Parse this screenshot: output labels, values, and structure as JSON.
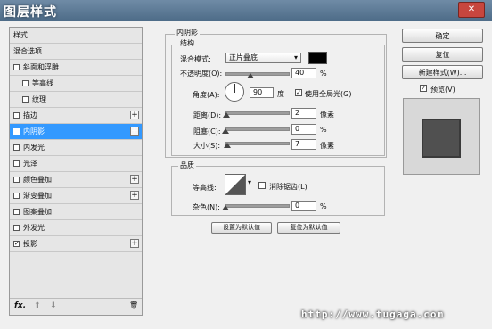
{
  "window": {
    "title": "图层样式",
    "close": "✕"
  },
  "sidebar": {
    "items": [
      {
        "label": "样式",
        "checkbox": false,
        "checked": false,
        "plus": false,
        "indent": false,
        "selected": false
      },
      {
        "label": "混合选项",
        "checkbox": false,
        "checked": false,
        "plus": false,
        "indent": false,
        "selected": false
      },
      {
        "label": "斜面和浮雕",
        "checkbox": true,
        "checked": false,
        "plus": false,
        "indent": false,
        "selected": false
      },
      {
        "label": "等高线",
        "checkbox": true,
        "checked": false,
        "plus": false,
        "indent": true,
        "selected": false
      },
      {
        "label": "纹理",
        "checkbox": true,
        "checked": false,
        "plus": false,
        "indent": true,
        "selected": false
      },
      {
        "label": "描边",
        "checkbox": true,
        "checked": false,
        "plus": true,
        "indent": false,
        "selected": false
      },
      {
        "label": "内阴影",
        "checkbox": true,
        "checked": true,
        "plus": true,
        "indent": false,
        "selected": true
      },
      {
        "label": "内发光",
        "checkbox": true,
        "checked": false,
        "plus": false,
        "indent": false,
        "selected": false
      },
      {
        "label": "光泽",
        "checkbox": true,
        "checked": false,
        "plus": false,
        "indent": false,
        "selected": false
      },
      {
        "label": "颜色叠加",
        "checkbox": true,
        "checked": false,
        "plus": true,
        "indent": false,
        "selected": false
      },
      {
        "label": "渐变叠加",
        "checkbox": true,
        "checked": false,
        "plus": true,
        "indent": false,
        "selected": false
      },
      {
        "label": "图案叠加",
        "checkbox": true,
        "checked": false,
        "plus": false,
        "indent": false,
        "selected": false
      },
      {
        "label": "外发光",
        "checkbox": true,
        "checked": false,
        "plus": false,
        "indent": false,
        "selected": false
      },
      {
        "label": "投影",
        "checkbox": true,
        "checked": true,
        "plus": true,
        "indent": false,
        "selected": false
      }
    ],
    "footer": {
      "fx": "fx.",
      "up": "⬆",
      "down": "⬇",
      "trash": "🗑"
    }
  },
  "inner_shadow": {
    "section_title": "内阴影",
    "structure_title": "结构",
    "blend_mode_label": "混合模式:",
    "blend_mode_value": "正片叠底",
    "shadow_color": "#000000",
    "opacity_label": "不透明度(O):",
    "opacity_value": "40",
    "opacity_level": 0.4,
    "angle_label": "角度(A):",
    "angle_value": "90",
    "angle_unit": "度",
    "global_light_label": "使用全局光(G)",
    "distance_label": "距离(D):",
    "distance_value": "2",
    "distance_level": 0.02,
    "choke_label": "阻塞(C):",
    "choke_value": "0",
    "choke_level": 0.0,
    "size_label": "大小(S):",
    "size_value": "7",
    "size_level": 0.03,
    "pixel_unit": "像素",
    "percent_unit": "%",
    "quality_title": "品质",
    "contour_label": "等高线:",
    "antialias_label": "消除锯齿(L)",
    "noise_label": "杂色(N):",
    "noise_value": "0",
    "noise_level": 0.0,
    "set_default_label": "设置为默认值",
    "reset_default_label": "复位为默认值"
  },
  "actions": {
    "ok_label": "确定",
    "reset_label": "复位",
    "new_style_label": "新建样式(W)...",
    "preview_label": "预览(V)"
  },
  "watermark": "http://www.tugaga.com"
}
